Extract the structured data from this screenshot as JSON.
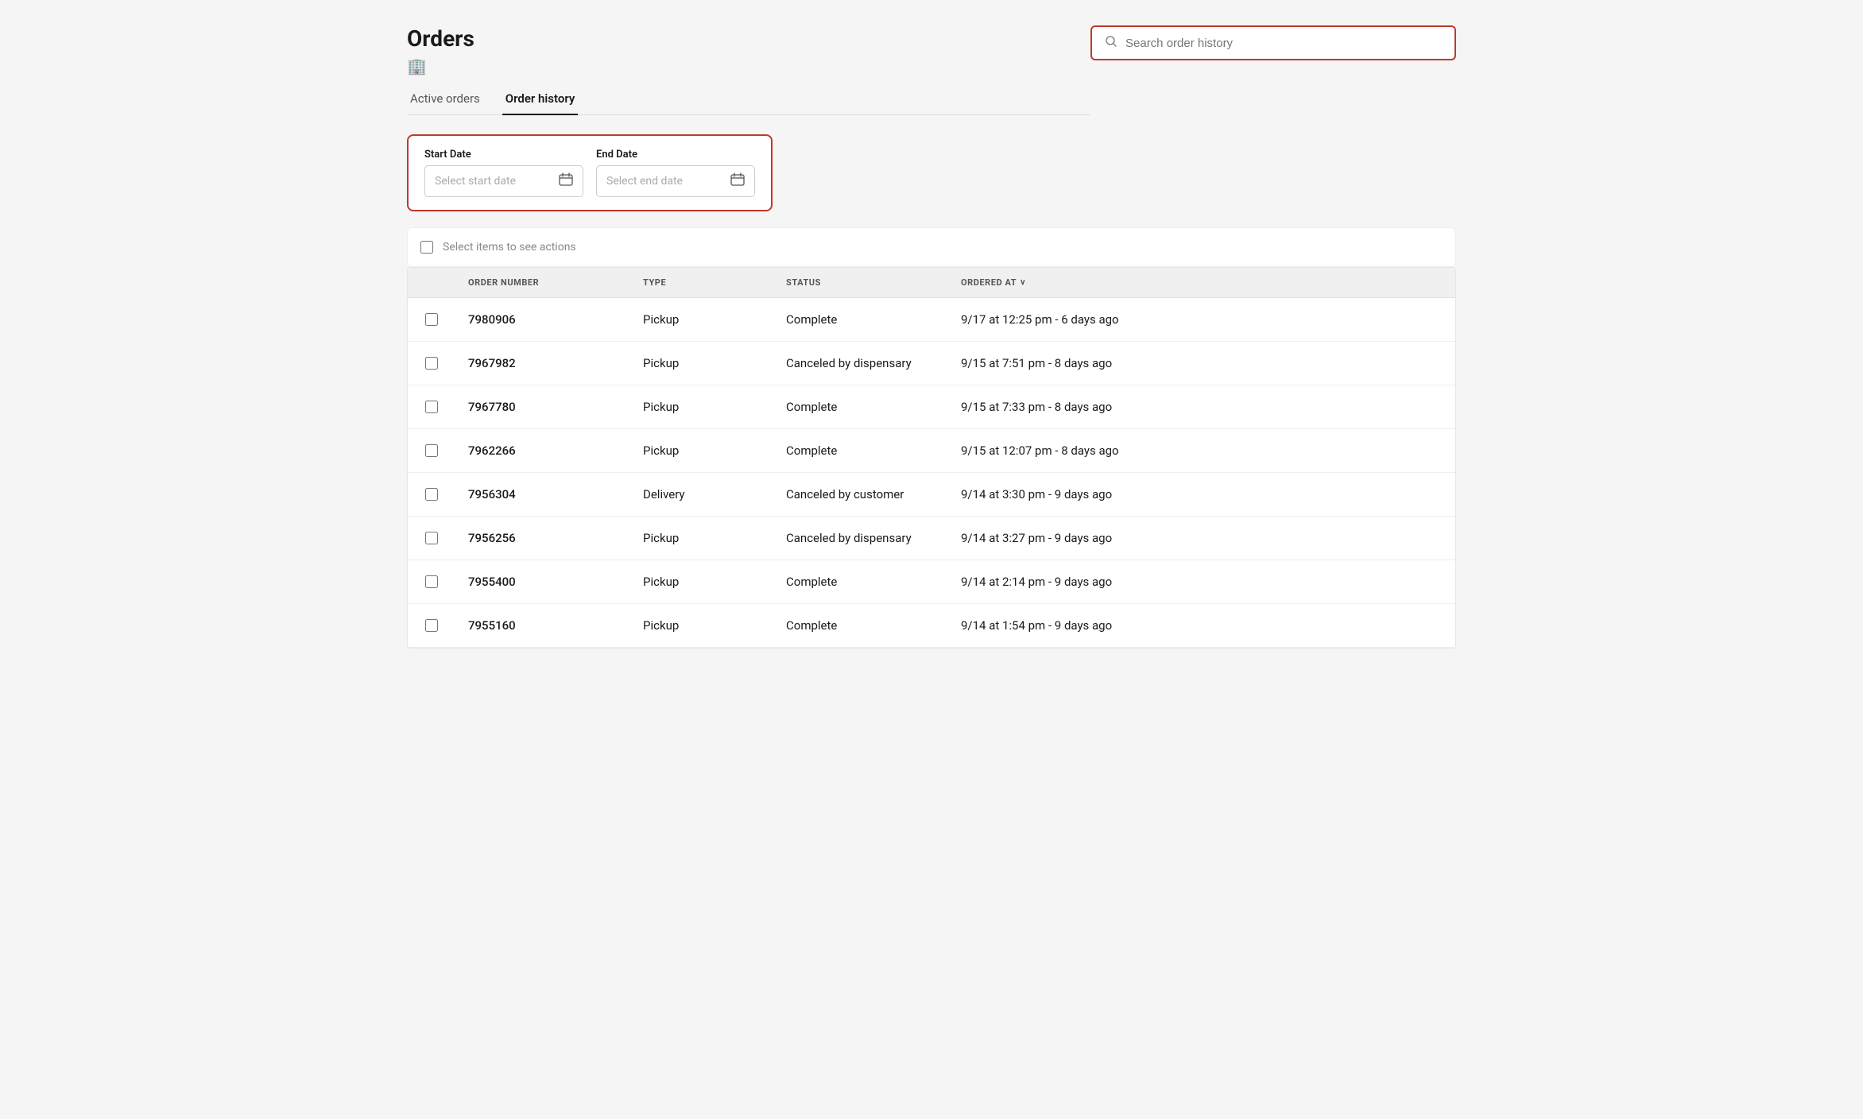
{
  "page": {
    "title": "Orders",
    "store_icon": "🏢"
  },
  "tabs": [
    {
      "id": "active",
      "label": "Active orders",
      "active": false
    },
    {
      "id": "history",
      "label": "Order history",
      "active": true
    }
  ],
  "search": {
    "placeholder": "Search order history"
  },
  "date_filter": {
    "start_label": "Start Date",
    "start_placeholder": "Select start date",
    "end_label": "End Date",
    "end_placeholder": "Select end date"
  },
  "actions_bar": {
    "label": "Select items to see actions"
  },
  "table": {
    "columns": [
      {
        "id": "checkbox",
        "label": ""
      },
      {
        "id": "order_number",
        "label": "ORDER NUMBER"
      },
      {
        "id": "type",
        "label": "TYPE"
      },
      {
        "id": "status",
        "label": "STATUS"
      },
      {
        "id": "ordered_at",
        "label": "ORDERED AT",
        "sortable": true
      }
    ],
    "rows": [
      {
        "order_number": "7980906",
        "type": "Pickup",
        "status": "Complete",
        "ordered_at": "9/17 at 12:25 pm - 6 days ago"
      },
      {
        "order_number": "7967982",
        "type": "Pickup",
        "status": "Canceled by dispensary",
        "ordered_at": "9/15 at 7:51 pm - 8 days ago"
      },
      {
        "order_number": "7967780",
        "type": "Pickup",
        "status": "Complete",
        "ordered_at": "9/15 at 7:33 pm - 8 days ago"
      },
      {
        "order_number": "7962266",
        "type": "Pickup",
        "status": "Complete",
        "ordered_at": "9/15 at 12:07 pm - 8 days ago"
      },
      {
        "order_number": "7956304",
        "type": "Delivery",
        "status": "Canceled by customer",
        "ordered_at": "9/14 at 3:30 pm - 9 days ago"
      },
      {
        "order_number": "7956256",
        "type": "Pickup",
        "status": "Canceled by dispensary",
        "ordered_at": "9/14 at 3:27 pm - 9 days ago"
      },
      {
        "order_number": "7955400",
        "type": "Pickup",
        "status": "Complete",
        "ordered_at": "9/14 at 2:14 pm - 9 days ago"
      },
      {
        "order_number": "7955160",
        "type": "Pickup",
        "status": "Complete",
        "ordered_at": "9/14 at 1:54 pm - 9 days ago"
      }
    ]
  }
}
